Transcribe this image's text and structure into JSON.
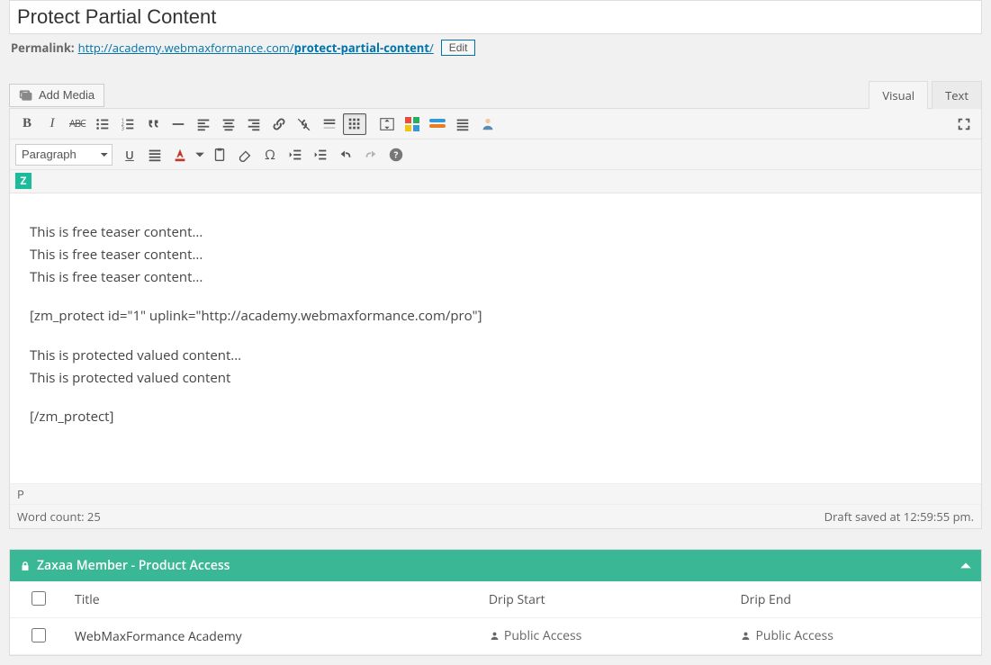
{
  "title": "Protect Partial Content",
  "permalink_label": "Permalink:",
  "permalink_base": "http://academy.webmaxformance.com/",
  "permalink_slug": "protect-partial-content",
  "edit_label": "Edit",
  "add_media_label": "Add Media",
  "tabs": {
    "visual": "Visual",
    "text": "Text"
  },
  "paragraph_label": "Paragraph",
  "content": {
    "l1": "This is free teaser content...",
    "l2": "This is free teaser content...",
    "l3": "This is free teaser content...",
    "sc_open": "[zm_protect id=\"1\" uplink=\"http://academy.webmaxformance.com/pro\"]",
    "p1": "This is protected valued content...",
    "p2": "This is protected valued content",
    "sc_close": "[/zm_protect]"
  },
  "path": "P",
  "word_count": "Word count: 25",
  "draft_saved": "Draft saved at 12:59:55 pm.",
  "panel_title": "Zaxaa Member - Product Access",
  "table": {
    "h_title": "Title",
    "h_start": "Drip Start",
    "h_end": "Drip End",
    "row1_title": "WebMaxFormance Academy",
    "public_access": "Public Access"
  },
  "z": "Z",
  "colors": {
    "brand_green": "#3ab795"
  }
}
